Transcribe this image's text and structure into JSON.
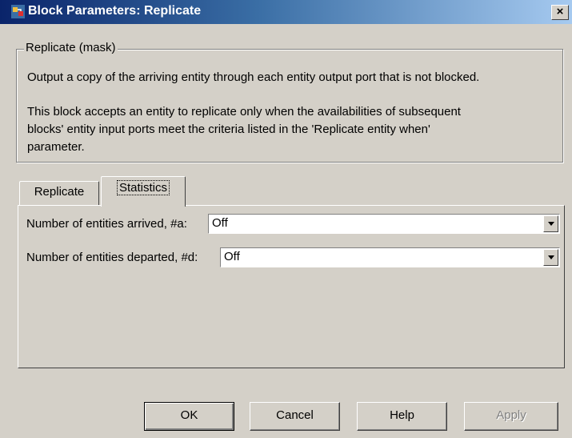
{
  "window": {
    "title": "Block Parameters: Replicate",
    "close_label": "×"
  },
  "mask_group": {
    "legend": "Replicate (mask)",
    "description_lines": [
      "Output a copy of the arriving entity through each entity output port that is not blocked.",
      "This block accepts an entity to replicate only when the availabilities of subsequent",
      "blocks' entity input ports meet the criteria listed in the 'Replicate entity when'",
      "parameter."
    ]
  },
  "tabs": [
    {
      "label": "Replicate",
      "active": false
    },
    {
      "label": "Statistics",
      "active": true
    }
  ],
  "statistics": {
    "arrived_label": "Number of entities arrived, #a:",
    "arrived_value": "Off",
    "departed_label": "Number of entities departed, #d:",
    "departed_value": "Off"
  },
  "buttons": {
    "ok": "OK",
    "cancel": "Cancel",
    "help": "Help",
    "apply": "Apply"
  },
  "colors": {
    "titlebar_start": "#0a246a",
    "titlebar_end": "#a6caf0",
    "face": "#d4d0c8"
  },
  "icons": {
    "window_icon": "simulink-block-icon",
    "dropdown": "chevron-down-icon"
  }
}
